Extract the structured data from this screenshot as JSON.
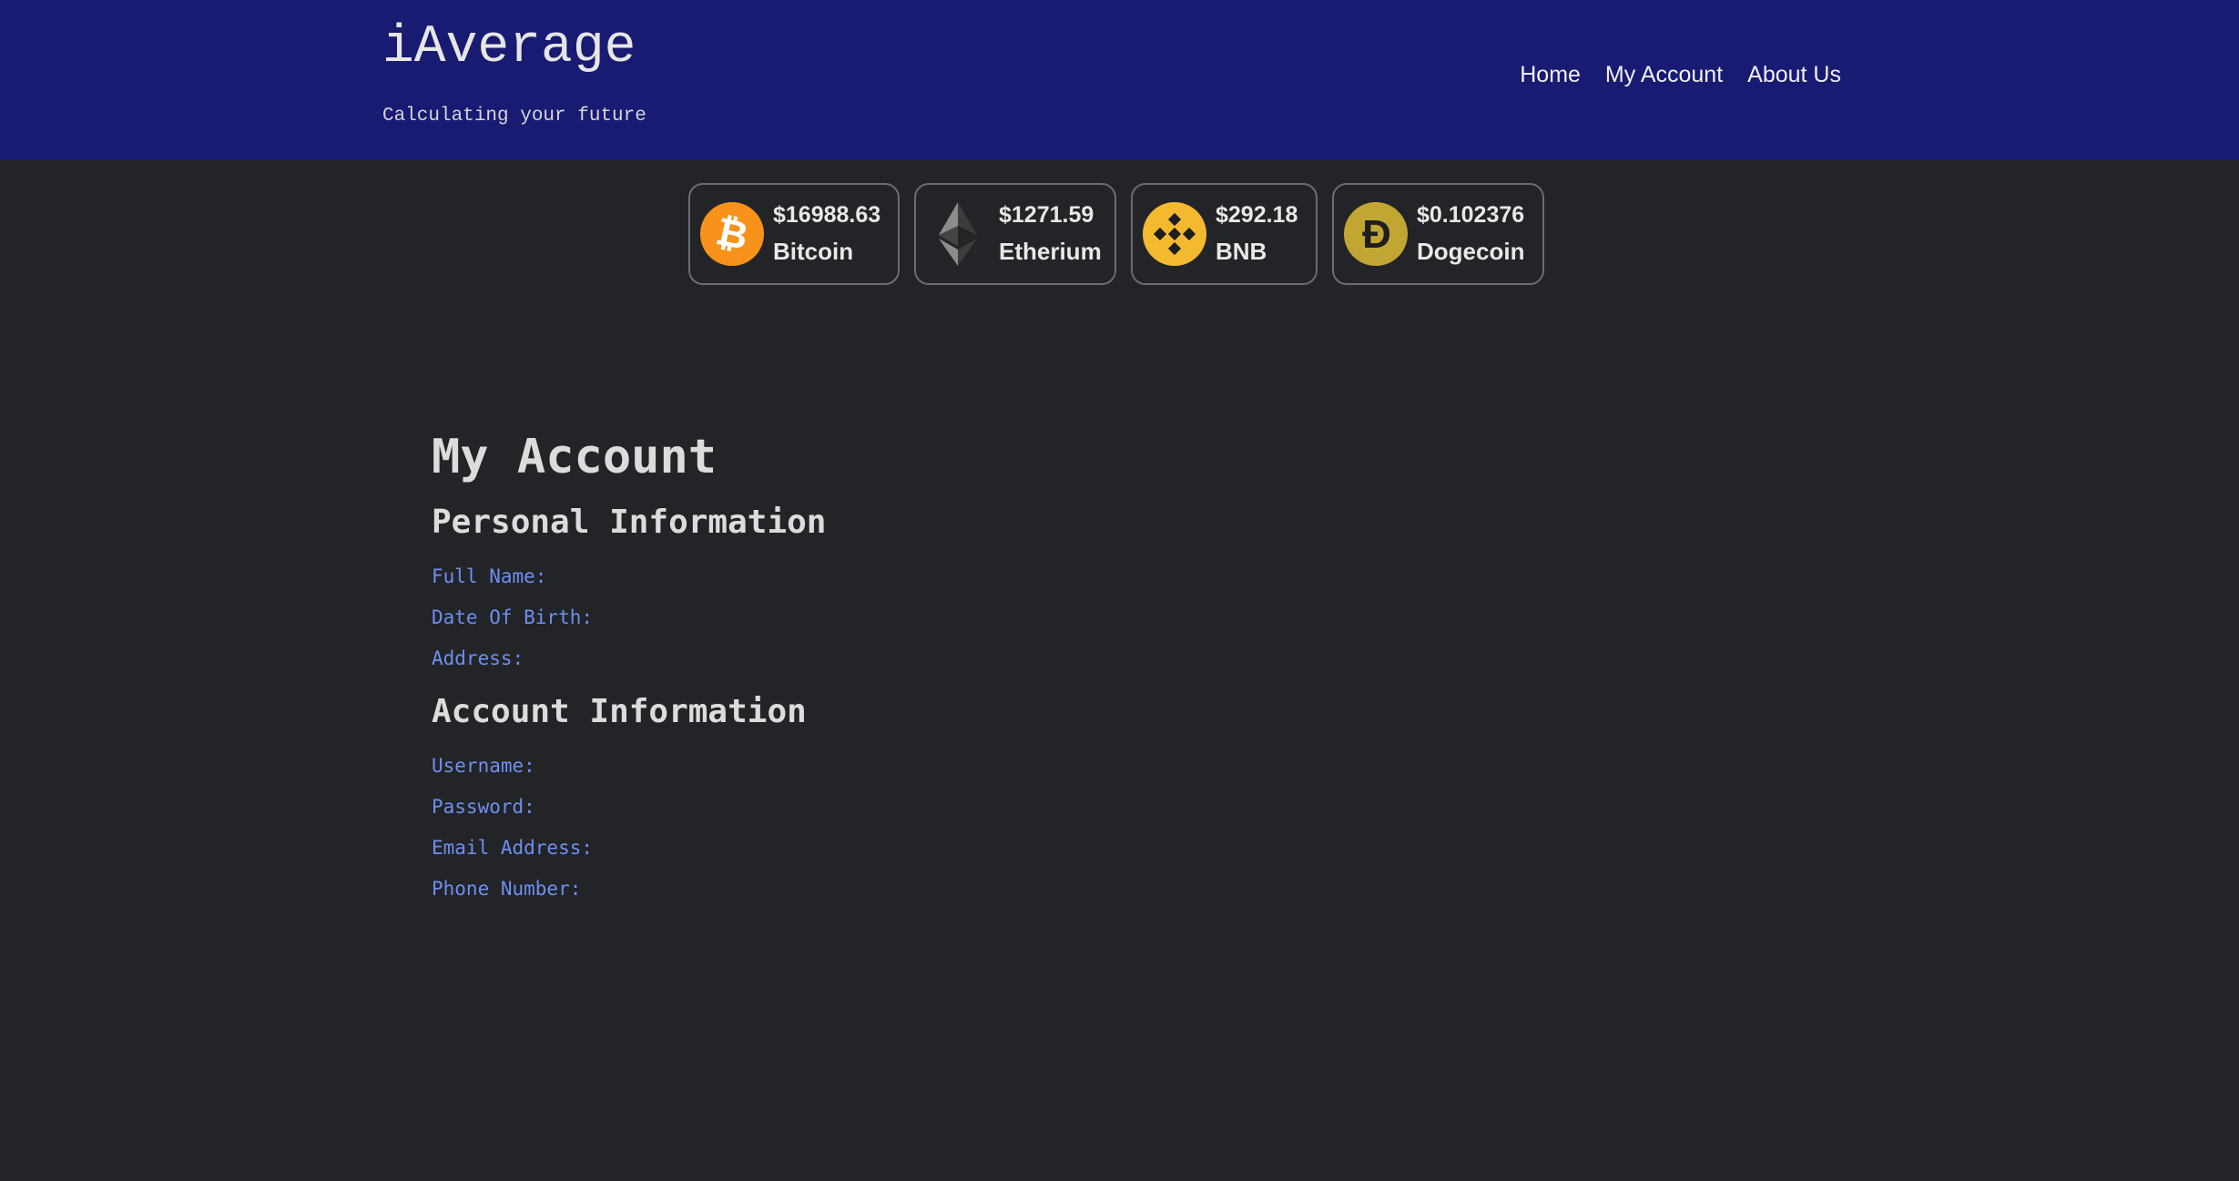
{
  "header": {
    "brand_title": "iAverage",
    "tagline": "Calculating your future",
    "nav": [
      {
        "label": "Home"
      },
      {
        "label": "My Account"
      },
      {
        "label": "About Us"
      }
    ],
    "background_color": "#191a72"
  },
  "ticker": [
    {
      "price": "$16988.63",
      "name": "Bitcoin",
      "icon": "bitcoin-icon",
      "color": "#f7931a"
    },
    {
      "price": "$1271.59",
      "name": "Etherium",
      "icon": "ethereum-icon",
      "color": "#8c8c8c"
    },
    {
      "price": "$292.18",
      "name": "BNB",
      "icon": "bnb-icon",
      "color": "#f3ba2f"
    },
    {
      "price": "$0.102376",
      "name": "Dogecoin",
      "icon": "dogecoin-icon",
      "color": "#c2a633"
    }
  ],
  "account": {
    "title": "My Account",
    "personal_title": "Personal Information",
    "personal_fields": [
      "Full Name:",
      "Date Of Birth:",
      "Address:"
    ],
    "account_title": "Account Information",
    "account_fields": [
      "Username:",
      "Password:",
      "Email Address:",
      "Phone Number:"
    ],
    "label_color": "#6d8ff0"
  }
}
